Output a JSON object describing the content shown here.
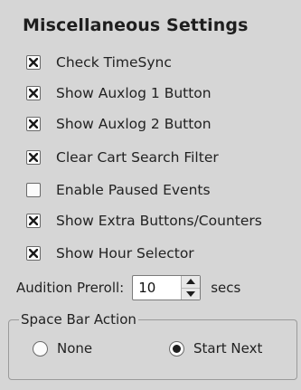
{
  "title": "Miscellaneous Settings",
  "checkboxes": [
    {
      "label": "Check TimeSync",
      "checked": true
    },
    {
      "label": "Show Auxlog 1 Button",
      "checked": true
    },
    {
      "label": "Show Auxlog 2 Button",
      "checked": true
    },
    {
      "label": "Clear Cart Search Filter",
      "checked": true
    },
    {
      "label": "Enable Paused Events",
      "checked": false
    },
    {
      "label": "Show Extra Buttons/Counters",
      "checked": true
    },
    {
      "label": "Show Hour Selector",
      "checked": true
    }
  ],
  "preroll": {
    "label": "Audition Preroll:",
    "value": "10",
    "unit": "secs"
  },
  "space_bar": {
    "title": "Space Bar Action",
    "options": [
      {
        "label": "None",
        "selected": false
      },
      {
        "label": "Start Next",
        "selected": true
      }
    ]
  }
}
